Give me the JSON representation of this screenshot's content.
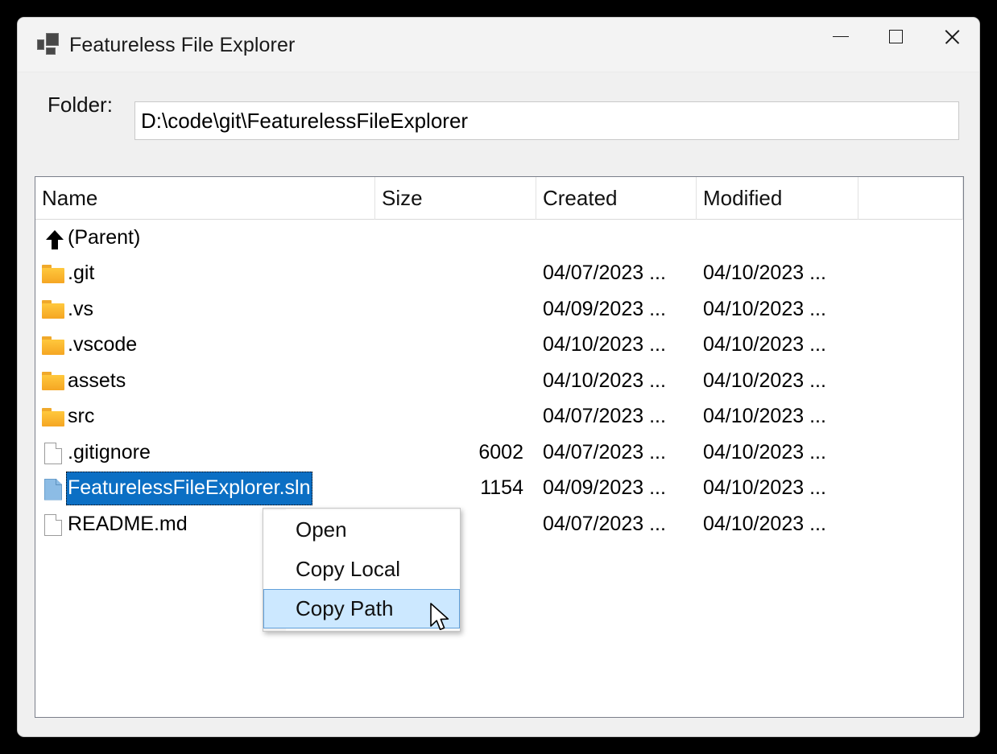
{
  "window": {
    "title": "Featureless File Explorer",
    "icon": "app-tiles-icon",
    "caption": {
      "minimize": "minimize-icon",
      "maximize": "maximize-icon",
      "close": "close-icon"
    }
  },
  "folder_bar": {
    "label": "Folder:",
    "path_value": "D:\\code\\git\\FeaturelessFileExplorer",
    "placeholder": "Folder path"
  },
  "listview": {
    "columns": [
      {
        "key": "name",
        "label": "Name"
      },
      {
        "key": "size",
        "label": "Size"
      },
      {
        "key": "created",
        "label": "Created"
      },
      {
        "key": "modified",
        "label": "Modified"
      },
      {
        "key": "extra",
        "label": ""
      }
    ],
    "rows": [
      {
        "icon": "up-arrow-icon",
        "name": "(Parent)",
        "size": "",
        "created": "",
        "modified": "",
        "selected": false
      },
      {
        "icon": "folder-icon",
        "name": ".git",
        "size": "",
        "created": "04/07/2023 ...",
        "modified": "04/10/2023 ...",
        "selected": false
      },
      {
        "icon": "folder-icon",
        "name": ".vs",
        "size": "",
        "created": "04/09/2023 ...",
        "modified": "04/10/2023 ...",
        "selected": false
      },
      {
        "icon": "folder-icon",
        "name": ".vscode",
        "size": "",
        "created": "04/10/2023 ...",
        "modified": "04/10/2023 ...",
        "selected": false
      },
      {
        "icon": "folder-icon",
        "name": "assets",
        "size": "",
        "created": "04/10/2023 ...",
        "modified": "04/10/2023 ...",
        "selected": false
      },
      {
        "icon": "folder-icon",
        "name": "src",
        "size": "",
        "created": "04/07/2023 ...",
        "modified": "04/10/2023 ...",
        "selected": false
      },
      {
        "icon": "file-icon",
        "name": ".gitignore",
        "size": "6002",
        "created": "04/07/2023 ...",
        "modified": "04/10/2023 ...",
        "selected": false
      },
      {
        "icon": "file-icon",
        "name": "FeaturelessFileExplorer.sln",
        "size": "1154",
        "created": "04/09/2023 ...",
        "modified": "04/10/2023 ...",
        "selected": true
      },
      {
        "icon": "file-icon",
        "name": "README.md",
        "size": "",
        "created": "04/07/2023 ...",
        "modified": "04/10/2023 ...",
        "selected": false
      }
    ]
  },
  "context_menu": {
    "items": [
      {
        "label": "Open",
        "highlighted": false
      },
      {
        "label": "Copy Local",
        "highlighted": false
      },
      {
        "label": "Copy Path",
        "highlighted": true
      }
    ]
  },
  "cursor": {
    "icon": "mouse-pointer-icon"
  },
  "colors": {
    "selection_blue": "#0B6FC4",
    "menu_highlight": "#CCE8FF",
    "menu_highlight_border": "#62A0DA",
    "folder_icon": "#F5A623",
    "window_bg": "#F0F0F0",
    "titlebar_bg": "#F3F3F3"
  }
}
